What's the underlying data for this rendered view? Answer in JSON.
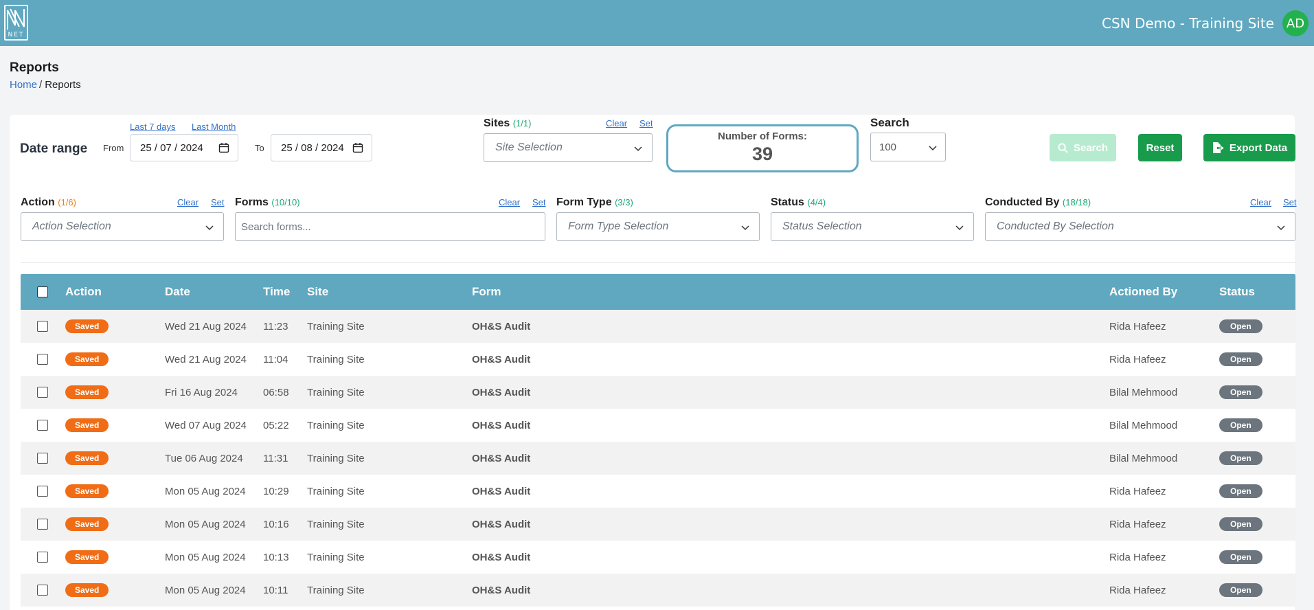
{
  "header": {
    "logo_text": "NET",
    "site_name": "CSN Demo - Training Site",
    "avatar_initials": "AD",
    "bg_color": "#5fa8c0"
  },
  "page": {
    "title": "Reports",
    "breadcrumb": {
      "home": "Home",
      "separator": "/",
      "current": "Reports"
    }
  },
  "filters": {
    "date_range": {
      "label": "Date range",
      "quick_last7": "Last 7 days",
      "quick_last_month": "Last Month",
      "from_label": "From",
      "from_value": "25 / 07 / 2024",
      "to_label": "To",
      "to_value": "25 / 08 / 2024"
    },
    "sites": {
      "label": "Sites",
      "count": "(1/1)",
      "clear": "Clear",
      "set": "Set",
      "placeholder": "Site Selection"
    },
    "number_of_forms": {
      "label": "Number of Forms:",
      "value": "39"
    },
    "search": {
      "label": "Search",
      "page_size": "100",
      "button": "Search",
      "reset": "Reset",
      "export": "Export Data"
    },
    "action": {
      "label": "Action",
      "count": "(1/6)",
      "clear": "Clear",
      "set": "Set",
      "placeholder": "Action Selection"
    },
    "forms": {
      "label": "Forms",
      "count": "(10/10)",
      "clear": "Clear",
      "set": "Set",
      "placeholder": "Search forms..."
    },
    "form_type": {
      "label": "Form Type",
      "count": "(3/3)",
      "placeholder": "Form Type Selection"
    },
    "status": {
      "label": "Status",
      "count": "(4/4)",
      "placeholder": "Status Selection"
    },
    "conducted_by": {
      "label": "Conducted By",
      "count": "(18/18)",
      "clear": "Clear",
      "set": "Set",
      "placeholder": "Conducted By Selection"
    }
  },
  "table": {
    "columns": [
      "Action",
      "Date",
      "Time",
      "Site",
      "Form",
      "Actioned By",
      "Status"
    ],
    "rows": [
      {
        "action": "Saved",
        "date": "Wed 21 Aug 2024",
        "time": "11:23",
        "site": "Training Site",
        "form": "OH&S Audit",
        "by": "Rida Hafeez",
        "status": "Open"
      },
      {
        "action": "Saved",
        "date": "Wed 21 Aug 2024",
        "time": "11:04",
        "site": "Training Site",
        "form": "OH&S Audit",
        "by": "Rida Hafeez",
        "status": "Open"
      },
      {
        "action": "Saved",
        "date": "Fri 16 Aug 2024",
        "time": "06:58",
        "site": "Training Site",
        "form": "OH&S Audit",
        "by": "Bilal Mehmood",
        "status": "Open"
      },
      {
        "action": "Saved",
        "date": "Wed 07 Aug 2024",
        "time": "05:22",
        "site": "Training Site",
        "form": "OH&S Audit",
        "by": "Bilal Mehmood",
        "status": "Open"
      },
      {
        "action": "Saved",
        "date": "Tue 06 Aug 2024",
        "time": "11:31",
        "site": "Training Site",
        "form": "OH&S Audit",
        "by": "Bilal Mehmood",
        "status": "Open"
      },
      {
        "action": "Saved",
        "date": "Mon 05 Aug 2024",
        "time": "10:29",
        "site": "Training Site",
        "form": "OH&S Audit",
        "by": "Rida Hafeez",
        "status": "Open"
      },
      {
        "action": "Saved",
        "date": "Mon 05 Aug 2024",
        "time": "10:16",
        "site": "Training Site",
        "form": "OH&S Audit",
        "by": "Rida Hafeez",
        "status": "Open"
      },
      {
        "action": "Saved",
        "date": "Mon 05 Aug 2024",
        "time": "10:13",
        "site": "Training Site",
        "form": "OH&S Audit",
        "by": "Rida Hafeez",
        "status": "Open"
      },
      {
        "action": "Saved",
        "date": "Mon 05 Aug 2024",
        "time": "10:11",
        "site": "Training Site",
        "form": "OH&S Audit",
        "by": "Rida Hafeez",
        "status": "Open"
      }
    ]
  }
}
